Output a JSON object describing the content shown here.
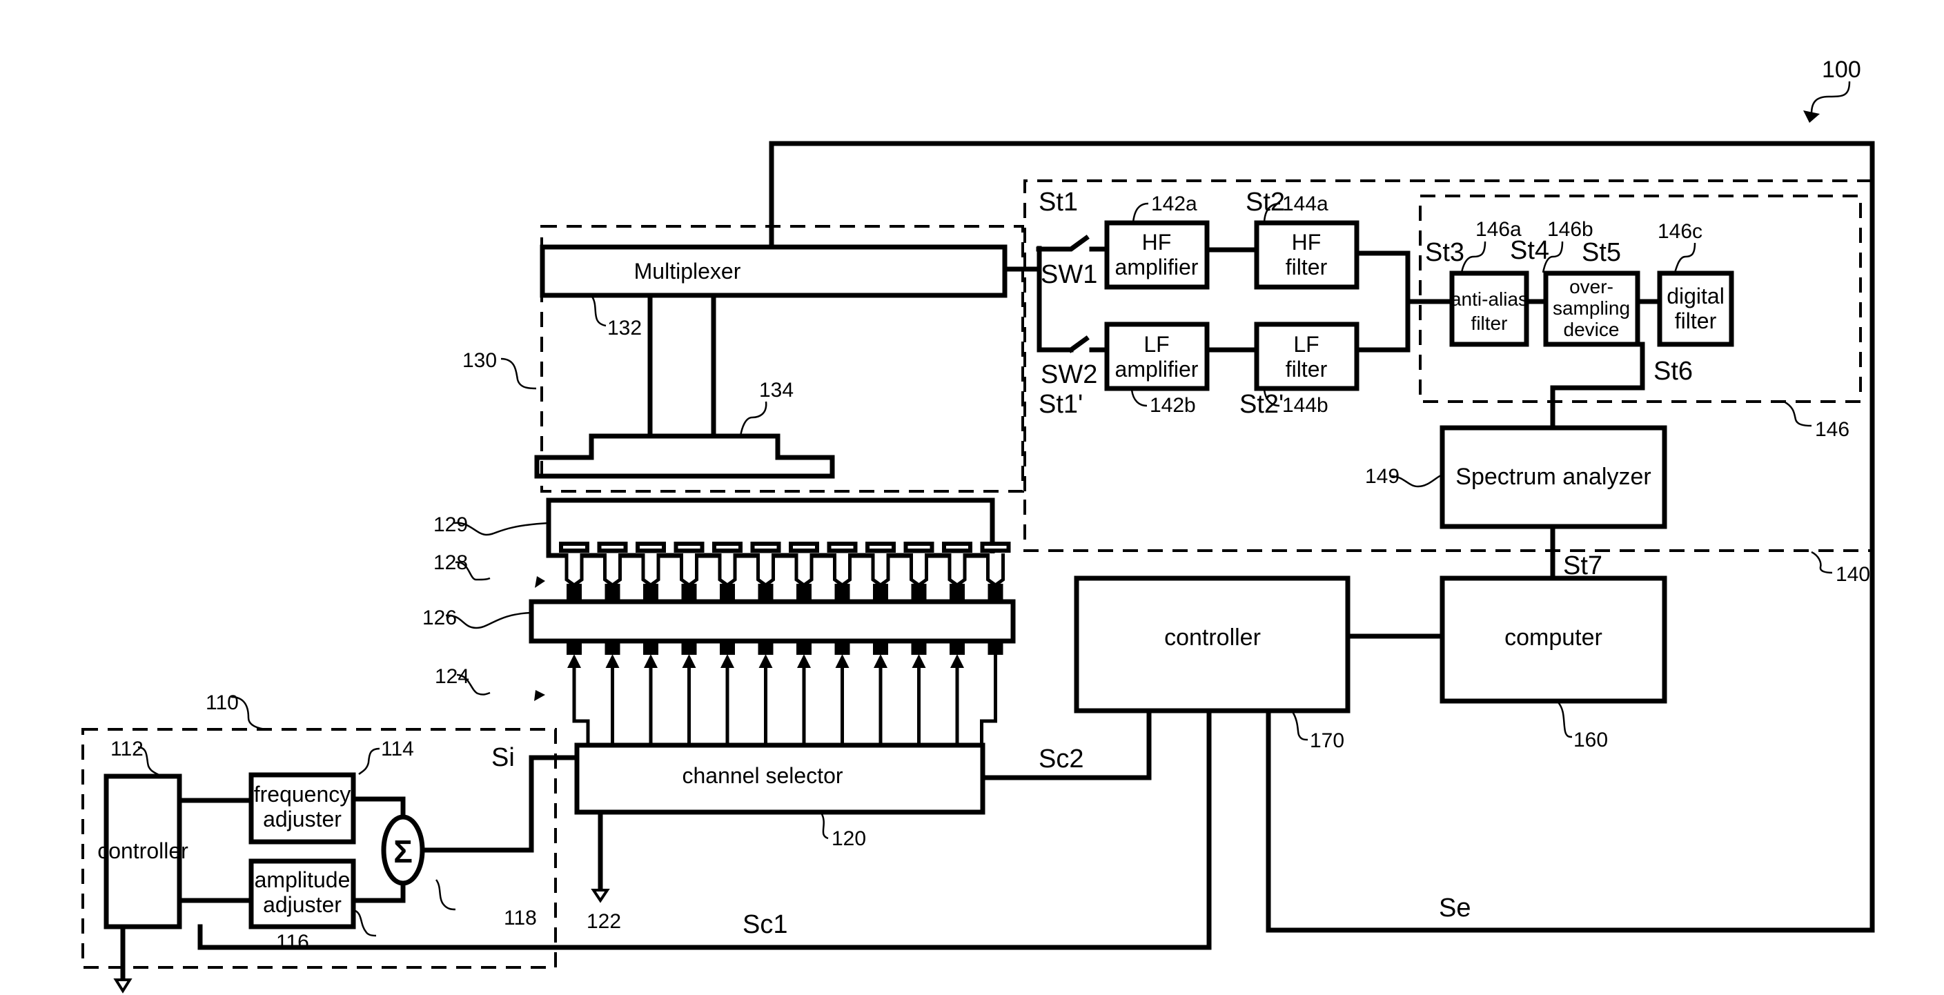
{
  "figure": {
    "reference": "100",
    "colors": {
      "ink": "#000000",
      "background": "#ffffff"
    }
  },
  "signal_generator": {
    "ref": "110",
    "controller": {
      "label": "controller",
      "ref": "112"
    },
    "frequency_adjuster": {
      "label_line1": "frequency",
      "label_line2": "adjuster",
      "ref": "114"
    },
    "amplitude_adjuster": {
      "label_line1": "amplitude",
      "label_line2": "adjuster",
      "ref": "116"
    },
    "summer": {
      "symbol": "Σ",
      "ref": "118"
    },
    "output_signal": "Si"
  },
  "channel_selector": {
    "label": "channel selector",
    "ref": "120",
    "ground_ref": "122"
  },
  "probes": {
    "lower_ref": "124",
    "board_ref": "126",
    "upper_ref": "128",
    "plate_ref": "129",
    "count": 12
  },
  "multiplexer_unit": {
    "ref": "130",
    "multiplexer": {
      "label": "Multiplexer",
      "ref": "132"
    },
    "fixture_ref": "134"
  },
  "measurement_unit": {
    "ref": "140",
    "switches": {
      "sw1": "SW1",
      "sw2": "SW2"
    },
    "stages": {
      "st1": "St1",
      "st1p": "St1'",
      "st2": "St2",
      "st2p": "St2'",
      "st3": "St3",
      "st4": "St4",
      "st5": "St5",
      "st6": "St6",
      "st7": "St7"
    },
    "hf_amplifier": {
      "line1": "HF",
      "line2": "amplifier",
      "ref": "142a"
    },
    "lf_amplifier": {
      "line1": "LF",
      "line2": "amplifier",
      "ref": "142b"
    },
    "hf_filter": {
      "line1": "HF",
      "line2": "filter",
      "ref": "144a"
    },
    "lf_filter": {
      "line1": "LF",
      "line2": "filter",
      "ref": "144b"
    },
    "digital_section": {
      "ref": "146",
      "anti_alias": {
        "line1": "anti-alias",
        "line2": "filter",
        "ref": "146a"
      },
      "oversampling": {
        "line1": "over-",
        "line2": "sampling",
        "line3": "device",
        "ref": "146b"
      },
      "digital_filter": {
        "line1": "digital",
        "line2": "filter",
        "ref": "146c"
      }
    },
    "spectrum_analyzer": {
      "label": "Spectrum analyzer",
      "ref": "149"
    }
  },
  "computer": {
    "label": "computer",
    "ref": "160"
  },
  "main_controller": {
    "label": "controller",
    "ref": "170"
  },
  "signals": {
    "sc1": "Sc1",
    "sc2": "Sc2",
    "se": "Se"
  }
}
